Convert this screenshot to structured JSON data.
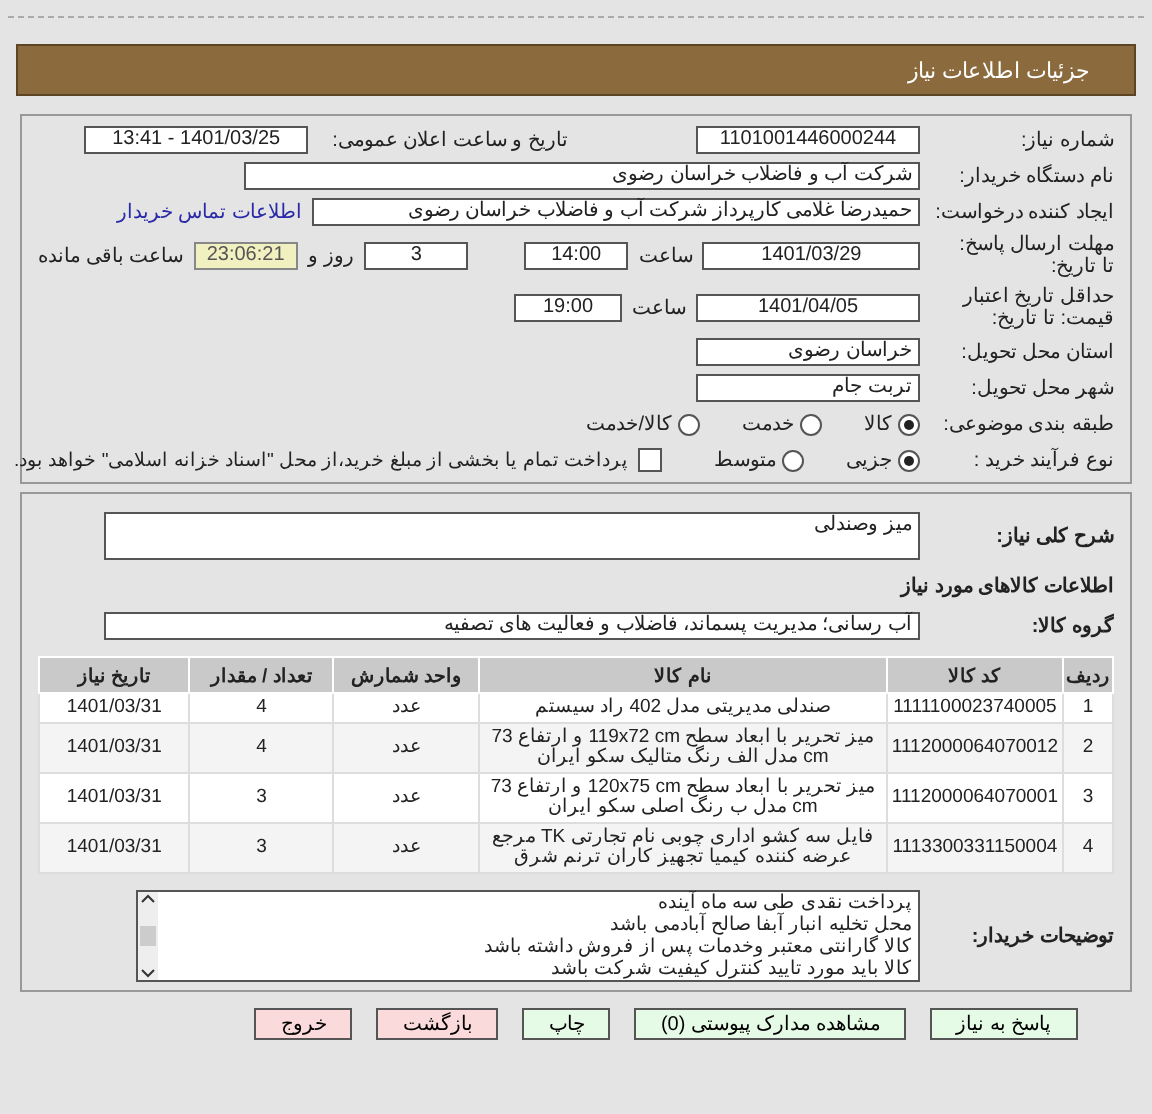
{
  "header": {
    "title": "جزئیات اطلاعات نیاز"
  },
  "need_number": {
    "label": "شماره نیاز:",
    "value": "1101001446000244"
  },
  "announce": {
    "label": "تاریخ و ساعت اعلان عمومی:",
    "value": "1401/03/25 - 13:41"
  },
  "buyer": {
    "label": "نام دستگاه خریدار:",
    "value": "شرکت آب و فاضلاب خراسان رضوی"
  },
  "creator": {
    "label": "ایجاد کننده درخواست:",
    "value": "حمیدرضا غلامی کارپرداز شرکت آب و فاضلاب خراسان رضوی",
    "link": "اطلاعات تماس خریدار"
  },
  "deadline": {
    "label": "مهلت ارسال پاسخ: تا تاریخ:",
    "date": "1401/03/29",
    "time_label": "ساعت",
    "time": "14:00",
    "days": "3",
    "days_label": "روز و",
    "remaining": "23:06:21",
    "remaining_label": "ساعت باقی مانده"
  },
  "validity": {
    "label": "حداقل تاریخ اعتبار قیمت: تا تاریخ:",
    "date": "1401/04/05",
    "time_label": "ساعت",
    "time": "19:00"
  },
  "province": {
    "label": "استان محل تحویل:",
    "value": "خراسان رضوی"
  },
  "city": {
    "label": "شهر محل تحویل:",
    "value": "تربت جام"
  },
  "category": {
    "label": "طبقه بندی موضوعی:",
    "options": [
      {
        "label": "کالا",
        "selected": true
      },
      {
        "label": "خدمت",
        "selected": false
      },
      {
        "label": "کالا/خدمت",
        "selected": false
      }
    ]
  },
  "process": {
    "label": "نوع فرآیند خرید :",
    "options": [
      {
        "label": "جزیی",
        "selected": true
      },
      {
        "label": "متوسط",
        "selected": false
      }
    ],
    "payment": {
      "checked": false,
      "label": "پرداخت تمام یا بخشی از مبلغ خرید،از محل \"اسناد خزانه اسلامی\" خواهد بود."
    }
  },
  "description": {
    "label": "شرح کلی نیاز:",
    "value": "میز وصندلی"
  },
  "items_heading": "اطلاعات کالاهای مورد نیاز",
  "group": {
    "label": "گروه کالا:",
    "value": "آب رسانی؛ مدیریت پسماند، فاضلاب و فعالیت های تصفیه"
  },
  "table": {
    "columns": [
      "ردیف",
      "کد کالا",
      "نام کالا",
      "واحد شمارش",
      "تعداد / مقدار",
      "تاریخ نیاز"
    ],
    "rows": [
      [
        "1",
        "1111100023740005",
        "صندلی مدیریتی مدل 402 راد سیستم",
        "عدد",
        "4",
        "1401/03/31"
      ],
      [
        "2",
        "1112000064070012",
        "میز تحریر با ابعاد سطح 119x72 cm و ارتفاع 73 cm مدل الف رنگ متالیک سکو ایران",
        "عدد",
        "4",
        "1401/03/31"
      ],
      [
        "3",
        "1112000064070001",
        "میز تحریر با ابعاد سطح 120x75 cm و ارتفاع 73 cm مدل ب رنگ اصلی سکو ایران",
        "عدد",
        "3",
        "1401/03/31"
      ],
      [
        "4",
        "1113300331150004",
        "فایل سه کشو اداری چوبی نام تجارتی TK مرجع عرضه کننده کیمیا تجهیز کاران ترنم شرق",
        "عدد",
        "3",
        "1401/03/31"
      ]
    ]
  },
  "notes": {
    "label": "توضیحات خریدار:",
    "lines": [
      "پرداخت نقدی طی سه ماه آینده",
      "محل تخلیه انبار آبفا صالح آبادمی باشد",
      "کالا گارانتی معتبر وخدمات پس از فروش داشته باشد",
      "کالا باید مورد تایید کنترل کیفیت شرکت باشد"
    ]
  },
  "buttons": [
    {
      "label": "پاسخ به نیاز",
      "kind": "green"
    },
    {
      "label": "مشاهده مدارک پیوستی (0)",
      "kind": "green"
    },
    {
      "label": "چاپ",
      "kind": "green"
    },
    {
      "label": "بازگشت",
      "kind": "red"
    },
    {
      "label": "خروج",
      "kind": "red"
    }
  ]
}
